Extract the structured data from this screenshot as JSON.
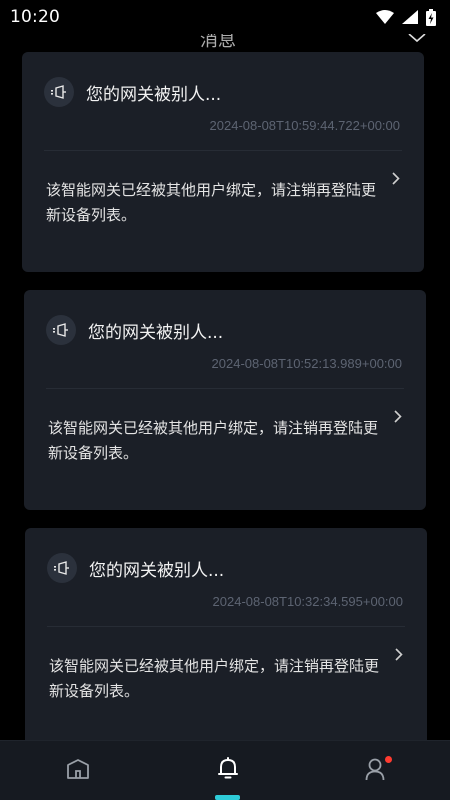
{
  "status_bar": {
    "time": "10:20",
    "icons": [
      "wifi-icon",
      "cellular-signal-icon",
      "battery-charging-icon"
    ]
  },
  "header": {
    "title": "消息",
    "collapse_icon": "chevron-down-icon"
  },
  "messages": [
    {
      "title": "您的网关被别人...",
      "timestamp": "2024-08-08T10:59:44.722+00:00",
      "body": "该智能网关已经被其他用户绑定，请注销再登陆更新设备列表。",
      "icon": "megaphone-icon"
    },
    {
      "title": "您的网关被别人...",
      "timestamp": "2024-08-08T10:52:13.989+00:00",
      "body": "该智能网关已经被其他用户绑定，请注销再登陆更新设备列表。",
      "icon": "megaphone-icon"
    },
    {
      "title": "您的网关被别人...",
      "timestamp": "2024-08-08T10:32:34.595+00:00",
      "body": "该智能网关已经被其他用户绑定，请注销再登陆更新设备列表。",
      "icon": "megaphone-icon"
    }
  ],
  "tabbar": {
    "tabs": [
      {
        "icon": "home-icon",
        "active": false
      },
      {
        "icon": "bell-icon",
        "active": true
      },
      {
        "icon": "user-icon",
        "active": false,
        "badge": true
      }
    ],
    "accent_color": "#2ecbd8",
    "badge_color": "#ff3b30"
  }
}
